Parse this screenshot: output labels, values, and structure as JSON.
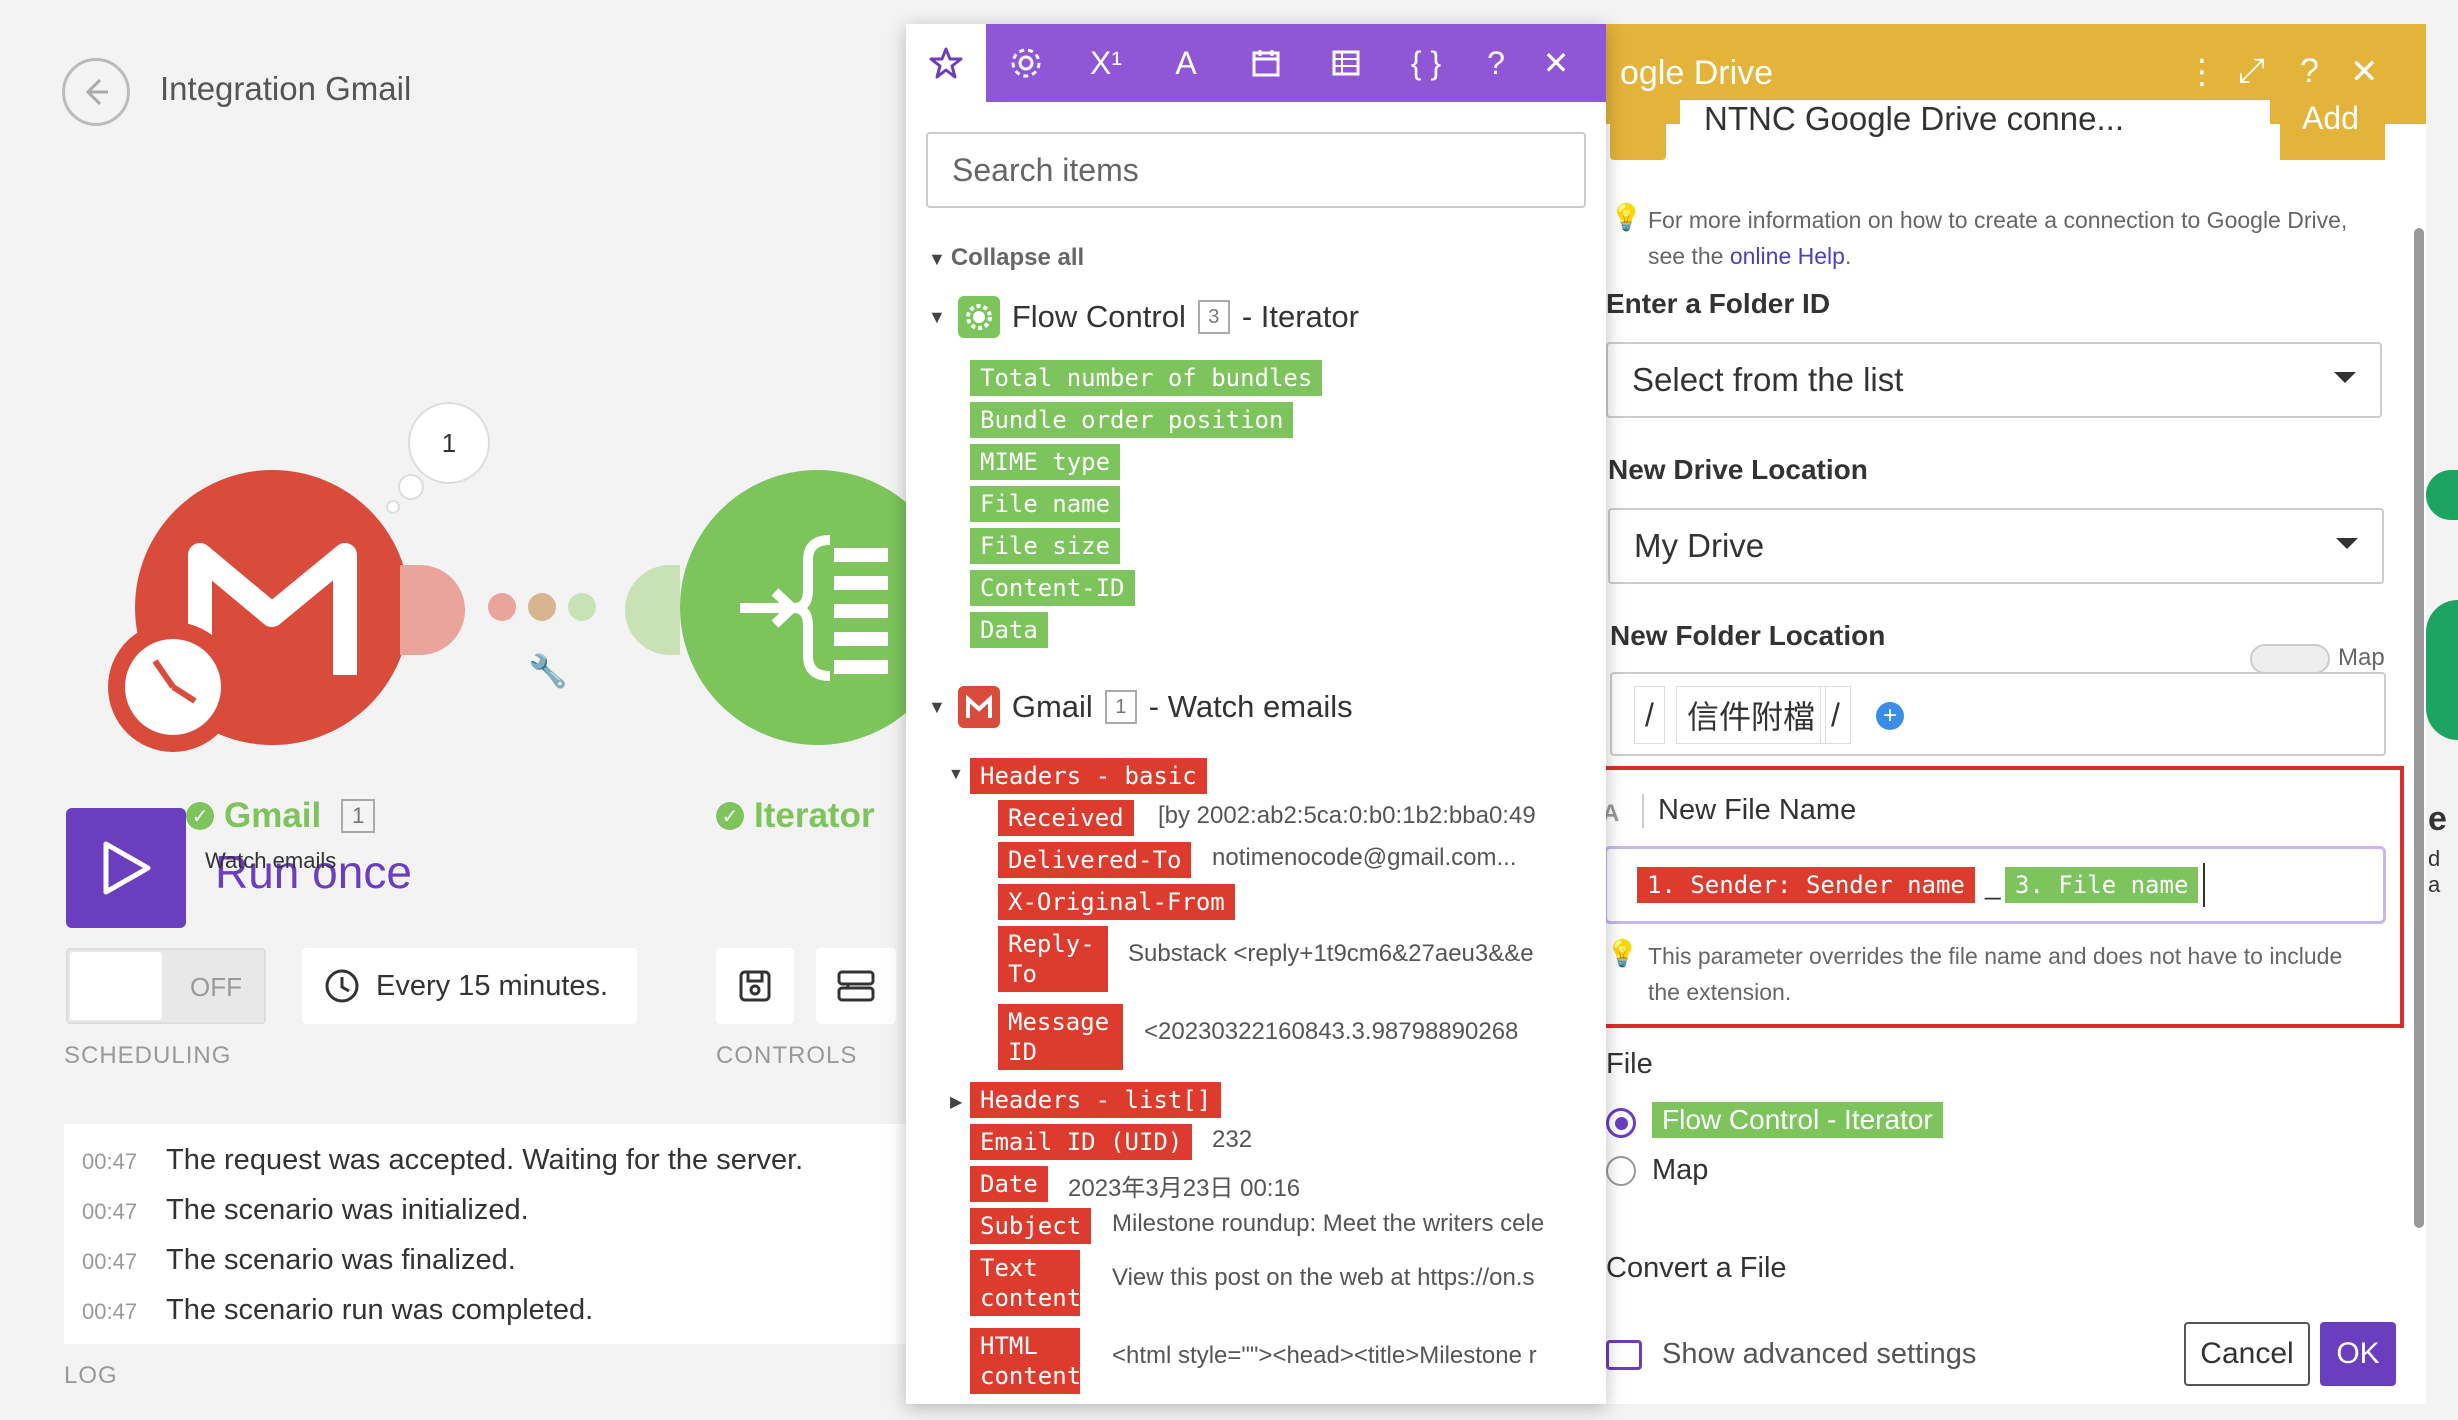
{
  "scenario": {
    "title": "Integration Gmail",
    "bubble_count": "1"
  },
  "modules": {
    "gmail": {
      "name": "Gmail",
      "count": "1",
      "subtitle": "Watch emails"
    },
    "iterator": {
      "name": "Iterator"
    }
  },
  "run": {
    "label": "Run once"
  },
  "scheduling": {
    "toggle_state": "OFF",
    "label": "SCHEDULING",
    "interval": "Every 15 minutes."
  },
  "controls": {
    "label": "CONTROLS"
  },
  "log": {
    "label": "LOG",
    "entries": [
      {
        "time": "00:47",
        "text": "The request was accepted. Waiting for the server."
      },
      {
        "time": "00:47",
        "text": "The scenario was initialized."
      },
      {
        "time": "00:47",
        "text": "The scenario was finalized."
      },
      {
        "time": "00:47",
        "text": "The scenario run was completed."
      }
    ]
  },
  "mapping_panel": {
    "toolbar_icons": [
      "star-icon",
      "gear-icon",
      "superscript-icon",
      "text-icon",
      "calendar-icon",
      "table-icon",
      "braces-icon",
      "help-icon",
      "close-icon"
    ],
    "toolbar_glyphs": {
      "superscript": "X¹",
      "text": "A",
      "braces": "{ }",
      "help": "?",
      "close": "✕"
    },
    "search_placeholder": "Search items",
    "collapse_all": "Collapse all",
    "flow_control": {
      "title": "Flow Control",
      "count": "3",
      "subtitle": "- Iterator",
      "items": [
        "Total number of bundles",
        "Bundle order position",
        "MIME type",
        "File name",
        "File size",
        "Content-ID",
        "Data"
      ]
    },
    "gmail": {
      "title": "Gmail",
      "count": "1",
      "subtitle": "- Watch emails",
      "headers_basic": "Headers - basic",
      "fields": [
        {
          "key": "Received",
          "value": "[by 2002:ab2:5ca:0:b0:1b2:bba0:49"
        },
        {
          "key": "Delivered-To",
          "value": "notimenocode@gmail.com..."
        },
        {
          "key": "X-Original-From",
          "value": ""
        },
        {
          "key": "Reply-To",
          "value": "Substack <reply+1t9cm6&27aeu3&&e"
        },
        {
          "key": "Message ID",
          "value": "<20230322160843.3.98798890268"
        }
      ],
      "headers_list": "Headers - list[]",
      "email_id_key": "Email ID (UID)",
      "email_id_value": "232",
      "date_key": "Date",
      "date_value": "2023年3月23日 00:16",
      "subject_key": "Subject",
      "subject_value": "Milestone roundup: Meet the writers cele",
      "text_key": "Text content",
      "text_value": "View this post on the web at https://on.s",
      "html_key": "HTML content",
      "html_value": "<html style=\"\"><head><title>Milestone r"
    }
  },
  "drive_panel": {
    "title": "ogle Drive",
    "header_glyphs": {
      "more": "⋮",
      "expand": "⤢",
      "help": "?",
      "close": "✕"
    },
    "connection": "NTNC Google Drive conne...",
    "add_label": "Add",
    "info_text": "For more information on how to create a connection to Google Drive, see the ",
    "info_link": "online Help",
    "info_end": ".",
    "folder_id_label": "Enter a Folder ID",
    "folder_id_value": "Select from the list",
    "drive_location_label": "New Drive Location",
    "drive_location_value": "My Drive",
    "folder_location_label": "New Folder Location",
    "map_label": "Map",
    "folder_path": [
      "/",
      "信件附檔",
      "/"
    ],
    "file_name_type_icon": "A",
    "file_name_label": "New File Name",
    "file_name_token1": "1. Sender: Sender name",
    "file_name_sep": "_",
    "file_name_token2": "3. File name",
    "file_name_hint": "This parameter overrides the file name and does not have to include the extension.",
    "file_label": "File",
    "file_option1": "Flow Control - Iterator",
    "file_option2": "Map",
    "convert_label": "Convert a File",
    "advanced_label": "Show advanced settings",
    "cancel_label": "Cancel",
    "ok_label": "OK"
  },
  "offscreen": {
    "letter": "e",
    "letters": "d a"
  },
  "colors": {
    "purple": "#6b3ec0",
    "gmail_red": "#d94b3b",
    "iterator_green": "#7cc45b",
    "drive_yellow": "#e3b33a",
    "highlight_red": "#d9302a"
  }
}
